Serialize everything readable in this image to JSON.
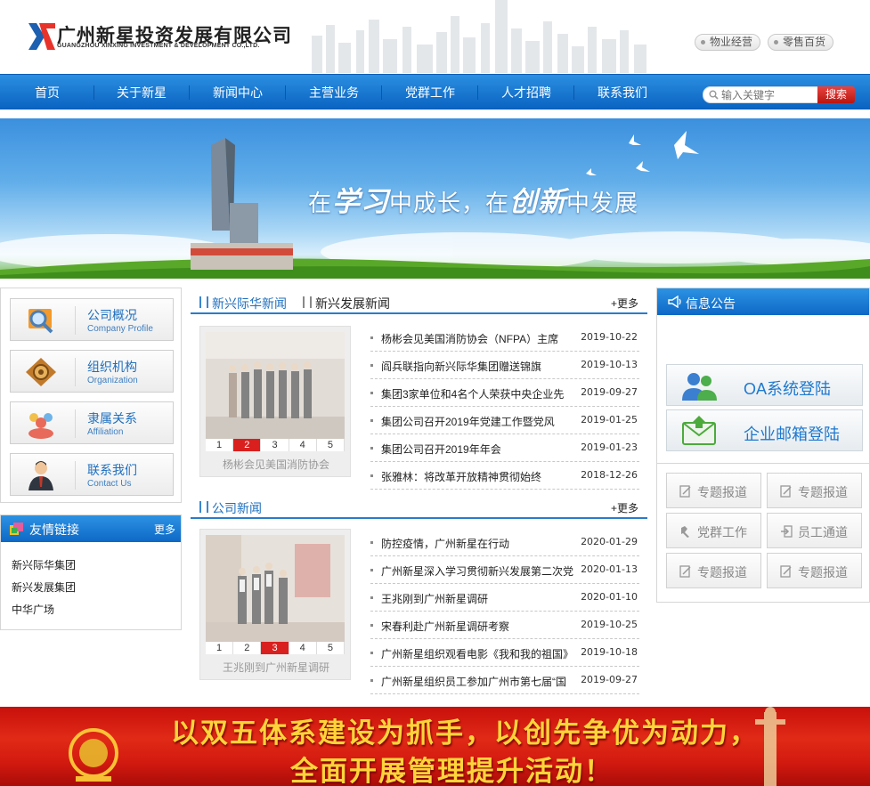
{
  "header": {
    "logo_cn": "广州新星投资发展有限公司",
    "logo_en": "GUANGZHOU XINXING INVESTMENT & DEVELOPMENT CO.,LTD.",
    "links": [
      "物业经营",
      "零售百货"
    ]
  },
  "nav": {
    "items": [
      "首页",
      "关于新星",
      "新闻中心",
      "主营业务",
      "党群工作",
      "人才招聘",
      "联系我们"
    ],
    "search_placeholder": "输入关键字",
    "search_button": "搜索"
  },
  "banner": {
    "text_1": "在",
    "text_2": "学习",
    "text_3": "中成长，在",
    "text_4": "创新",
    "text_5": "中发展"
  },
  "sidebar": {
    "buttons": [
      {
        "cn": "公司概况",
        "en": "Company Profile",
        "icon": "magnifier-icon"
      },
      {
        "cn": "组织机构",
        "en": "Organization",
        "icon": "gear-icon"
      },
      {
        "cn": "隶属关系",
        "en": "Affiliation",
        "icon": "people-group-icon"
      },
      {
        "cn": "联系我们",
        "en": "Contact Us",
        "icon": "person-contact-icon"
      }
    ],
    "links_title": "友情链接",
    "links_more": "更多",
    "links": [
      "新兴际华集团",
      "新兴发展集团",
      "中华广场"
    ]
  },
  "news1": {
    "tabs": [
      "新兴际华新闻",
      "新兴发展新闻"
    ],
    "more": "+更多",
    "pager": [
      "1",
      "2",
      "3",
      "4",
      "5"
    ],
    "pager_active": 2,
    "caption": "杨彬会见美国消防协会",
    "items": [
      {
        "title": "杨彬会见美国消防协会（NFPA）主席",
        "date": "2019-10-22"
      },
      {
        "title": "阎兵联指向新兴际华集团赠送锦旗",
        "date": "2019-10-13"
      },
      {
        "title": "集团3家单位和4名个人荣获中央企业先",
        "date": "2019-09-27"
      },
      {
        "title": "集团公司召开2019年党建工作暨党风",
        "date": "2019-01-25"
      },
      {
        "title": "集团公司召开2019年年会",
        "date": "2019-01-23"
      },
      {
        "title": "张雅林：将改革开放精神贯彻始终",
        "date": "2018-12-26"
      }
    ]
  },
  "news2": {
    "tab": "公司新闻",
    "more": "+更多",
    "pager": [
      "1",
      "2",
      "3",
      "4",
      "5"
    ],
    "pager_active": 3,
    "caption": "王兆刚到广州新星调研",
    "items": [
      {
        "title": "防控疫情，广州新星在行动",
        "date": "2020-01-29"
      },
      {
        "title": "广州新星深入学习贯彻新兴发展第二次党",
        "date": "2020-01-13"
      },
      {
        "title": "王兆刚到广州新星调研",
        "date": "2020-01-10"
      },
      {
        "title": "宋春利赴广州新星调研考察",
        "date": "2019-10-25"
      },
      {
        "title": "广州新星组织观看电影《我和我的祖国》",
        "date": "2019-10-18"
      },
      {
        "title": "广州新星组织员工参加广州市第七届“国",
        "date": "2019-09-27"
      }
    ]
  },
  "right": {
    "notice_title": "信息公告",
    "oa_login": "OA系统登陆",
    "mail_login": "企业邮箱登陆",
    "quick": [
      "专题报道",
      "专题报道",
      "党群工作",
      "员工通道",
      "专题报道",
      "专题报道"
    ]
  },
  "bottom_banner": {
    "line1": "以双五体系建设为抓手，以创先争优为动力，",
    "line2": "全面开展管理提升活动！"
  }
}
